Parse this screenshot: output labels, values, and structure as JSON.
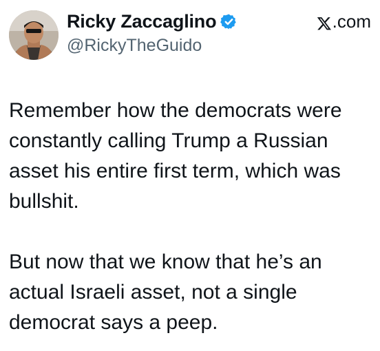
{
  "author": {
    "display_name": "Ricky Zaccaglino",
    "handle": "@RickyTheGuido",
    "avatar_icon": "avatar-photo",
    "verified_icon": "verified-badge-icon",
    "verified_color": "#1d9bf0"
  },
  "source": {
    "icon": "x-logo-icon",
    "label": ".com"
  },
  "tweet": {
    "paragraphs": [
      {
        "lines": [
          "Remember how the democrats were",
          "constantly calling Trump a Russian",
          "asset his entire first term, which was",
          "bullshit."
        ]
      },
      {
        "lines": [
          "But now that we know that he’s an",
          "actual Israeli asset, not a single",
          "democrat says a peep."
        ]
      }
    ]
  }
}
